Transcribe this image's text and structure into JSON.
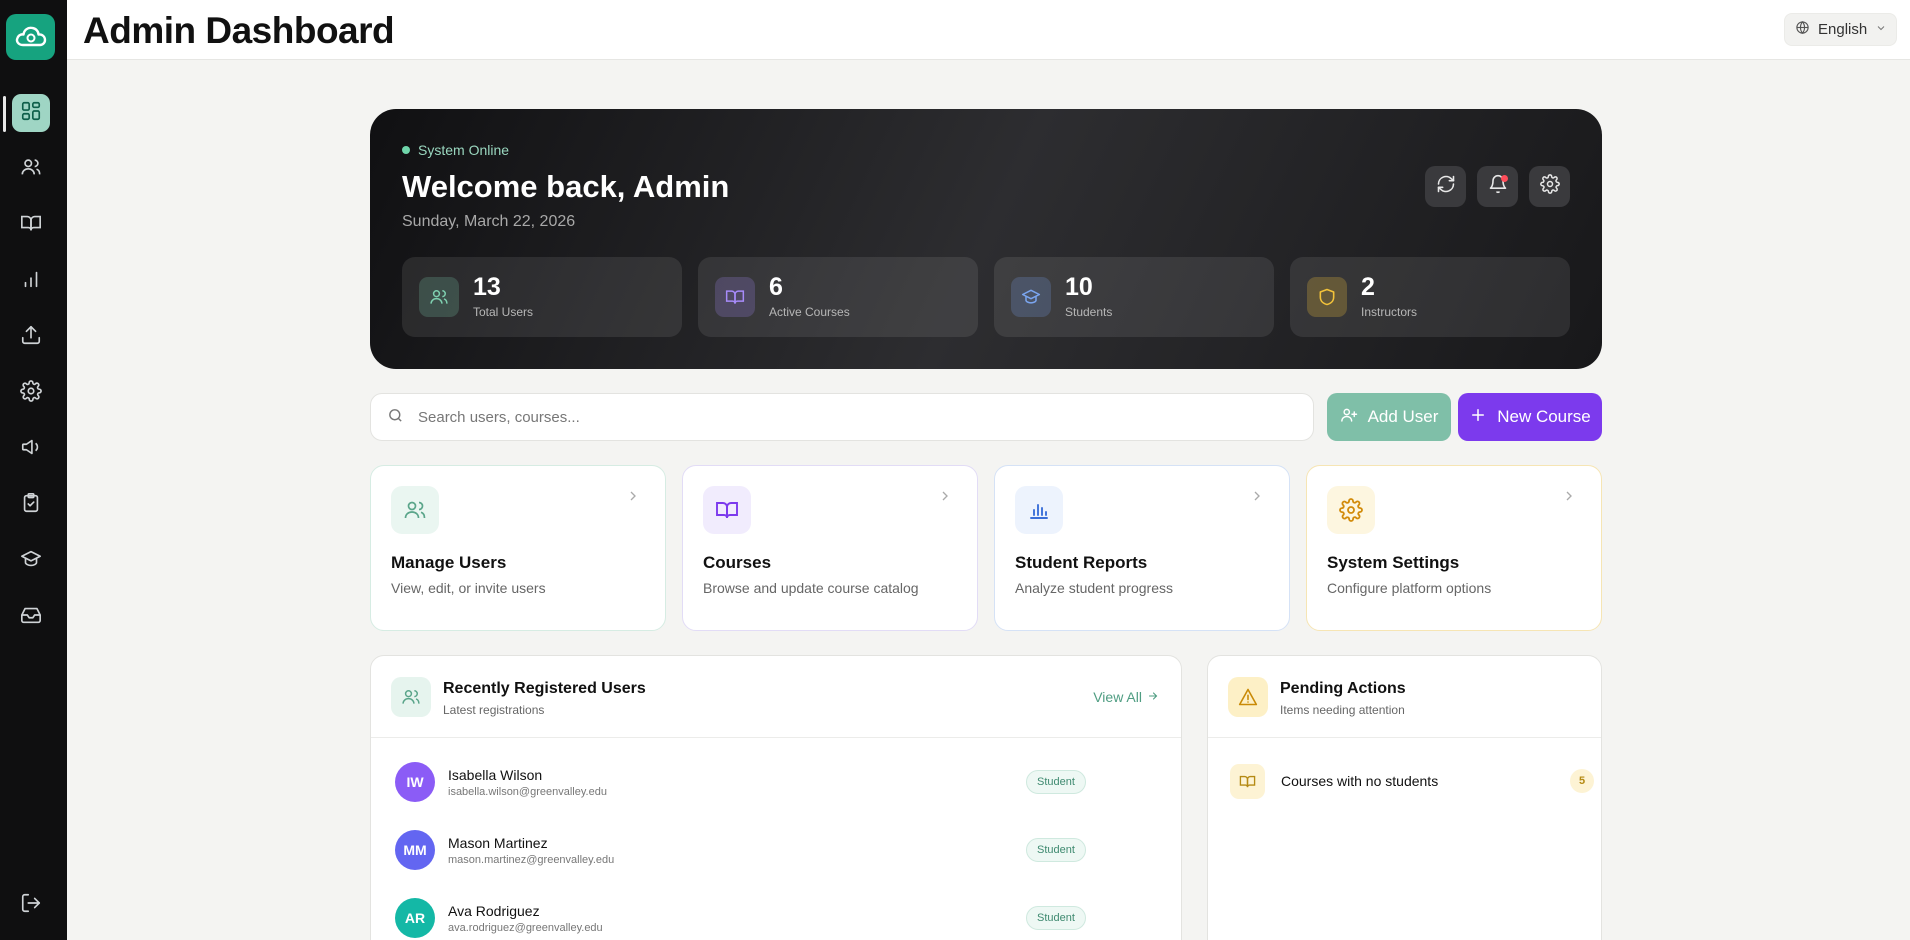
{
  "header": {
    "title": "Admin Dashboard",
    "language": "English"
  },
  "hero": {
    "status": "System Online",
    "welcome": "Welcome back, Admin",
    "date": "Sunday, March 22, 2026",
    "stats": [
      {
        "value": "13",
        "label": "Total Users",
        "color": "#7fd0b0"
      },
      {
        "value": "6",
        "label": "Active Courses",
        "color": "#a78bfa"
      },
      {
        "value": "10",
        "label": "Students",
        "color": "#7ba6f0"
      },
      {
        "value": "2",
        "label": "Instructors",
        "color": "#f3c33a"
      }
    ]
  },
  "search": {
    "placeholder": "Search users, courses..."
  },
  "actions": {
    "add_user": "Add User",
    "new_course": "New Course"
  },
  "quick_cards": [
    {
      "title": "Manage Users",
      "desc": "View, edit, or invite users"
    },
    {
      "title": "Courses",
      "desc": "Browse and update course catalog"
    },
    {
      "title": "Student Reports",
      "desc": "Analyze student progress"
    },
    {
      "title": "System Settings",
      "desc": "Configure platform options"
    }
  ],
  "recent_users": {
    "title": "Recently Registered Users",
    "subtitle": "Latest registrations",
    "view_all": "View All",
    "users": [
      {
        "initials": "IW",
        "name": "Isabella Wilson",
        "email": "isabella.wilson@greenvalley.edu",
        "role": "Student",
        "color": "#8b5cf6"
      },
      {
        "initials": "MM",
        "name": "Mason Martinez",
        "email": "mason.martinez@greenvalley.edu",
        "role": "Student",
        "color": "#6366f1"
      },
      {
        "initials": "AR",
        "name": "Ava Rodriguez",
        "email": "ava.rodriguez@greenvalley.edu",
        "role": "Student",
        "color": "#14b8a6"
      }
    ]
  },
  "pending": {
    "title": "Pending Actions",
    "subtitle": "Items needing attention",
    "items": [
      {
        "label": "Courses with no students",
        "count": "5"
      }
    ]
  },
  "colors": {
    "accent": "#7c3aed",
    "brand": "#16a37f",
    "accent_green": "#7fbfa8"
  }
}
